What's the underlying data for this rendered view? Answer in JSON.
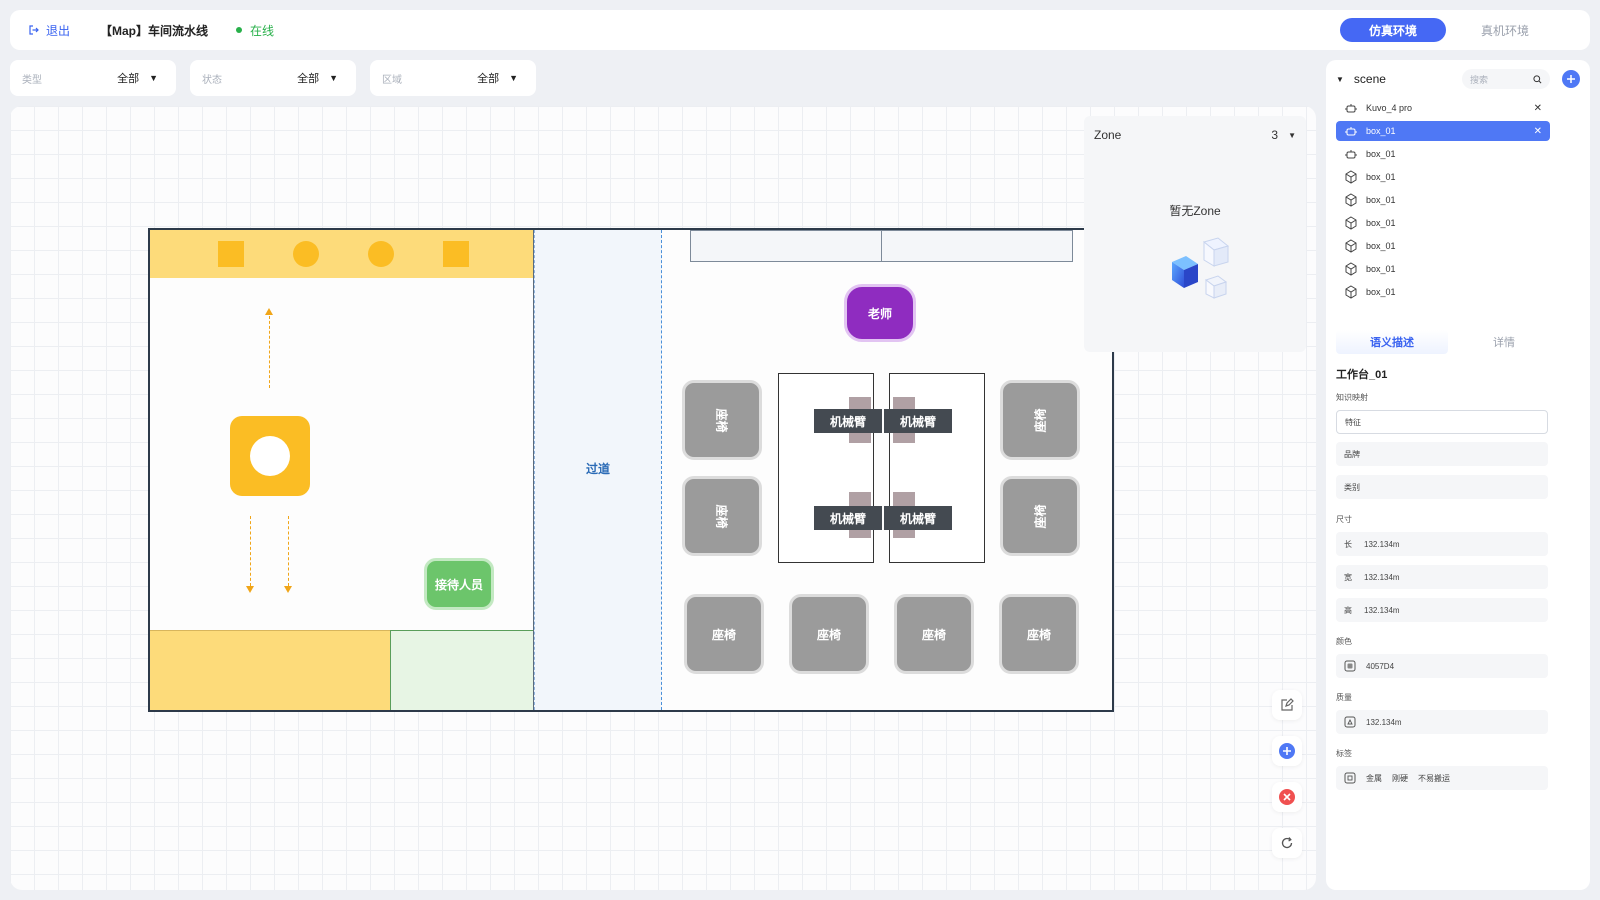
{
  "header": {
    "exit_label": "退出",
    "title": "【Map】车间流水线",
    "status": "在线",
    "env_active": "仿真环境",
    "env_inactive": "真机环境"
  },
  "filters": [
    {
      "label": "类型",
      "value": "全部"
    },
    {
      "label": "状态",
      "value": "全部"
    },
    {
      "label": "区域",
      "value": "全部"
    }
  ],
  "map": {
    "aisle_label": "过道",
    "receptionist_label": "接待人员",
    "teacher_label": "老师",
    "chair_label": "座椅",
    "arm_label": "机械臂"
  },
  "zone_panel": {
    "title": "Zone",
    "count": "3",
    "empty_text": "暂无Zone"
  },
  "scene": {
    "title": "scene",
    "search_placeholder": "搜索",
    "items": [
      {
        "label": "Kuvo_4 pro",
        "icon": "robot-icon"
      },
      {
        "label": "box_01",
        "icon": "robot-icon"
      },
      {
        "label": "box_01",
        "icon": "robot-icon"
      },
      {
        "label": "box_01",
        "icon": "cube-icon"
      },
      {
        "label": "box_01",
        "icon": "cube-icon"
      },
      {
        "label": "box_01",
        "icon": "cube-icon"
      },
      {
        "label": "box_01",
        "icon": "cube-icon"
      },
      {
        "label": "box_01",
        "icon": "cube-icon"
      },
      {
        "label": "box_01",
        "icon": "cube-icon"
      }
    ]
  },
  "props": {
    "tab_active": "语义描述",
    "tab_inactive": "详情",
    "object_name": "工作台_01",
    "knowledge_label": "知识映射",
    "feature_placeholder": "特征",
    "brand_placeholder": "品牌",
    "category_placeholder": "类别",
    "size_label": "尺寸",
    "length_key": "长",
    "length_value": "132.134m",
    "width_key": "宽",
    "width_value": "132.134m",
    "height_key": "高",
    "height_value": "132.134m",
    "color_label": "颜色",
    "color_value": "4057D4",
    "mass_label": "质量",
    "mass_value": "132.134m",
    "tags_label": "标签",
    "tags": [
      "金属",
      "刚硬",
      "不易搬运"
    ]
  },
  "colors": {
    "accent": "#4568f4",
    "online": "#28b04a",
    "teacher": "#8f2cc0",
    "receptionist": "#6cc56b",
    "yellow_zone": "#fddb7a"
  }
}
